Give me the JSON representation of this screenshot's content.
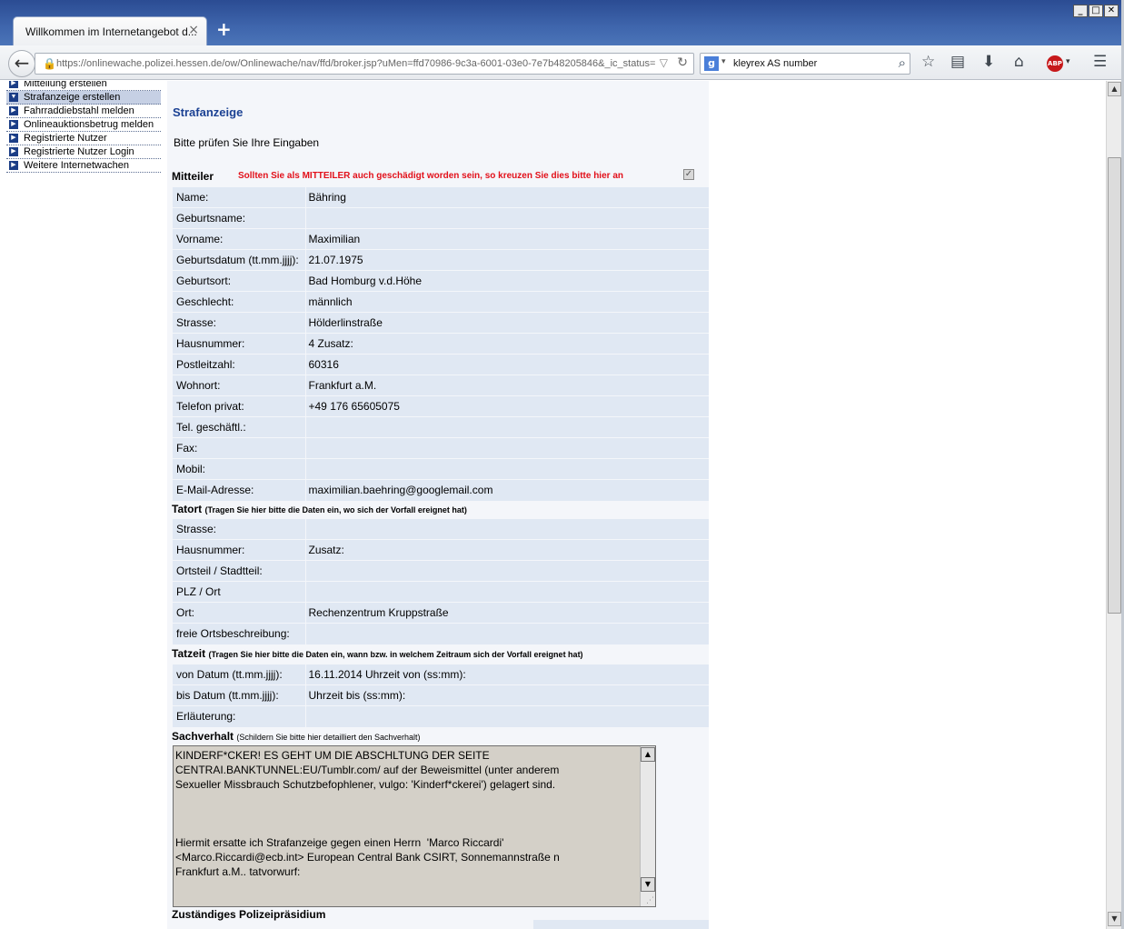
{
  "browser": {
    "tab_title": "Willkommen im Internetangebot d...",
    "tab_close": "×",
    "new_tab": "+",
    "url": "https://onlinewache.polizei.hessen.de/ow/Onlinewache/nav/ffd/broker.jsp?uMen=ffd70986-9c3a-6001-03e0-7e7b48205846&_ic_status=",
    "search_engine": "g",
    "search_text": "kleyrex AS number",
    "icons": [
      "back-icon",
      "lock-icon",
      "reload-icon",
      "search-icon",
      "bookmark-star-icon",
      "reading-list-icon",
      "download-icon",
      "home-icon",
      "adblock-icon",
      "menu-icon"
    ],
    "abp_label": "ABP"
  },
  "sidebar": {
    "items": [
      {
        "label": "Mitteilung erstellen"
      },
      {
        "label": "Strafanzeige erstellen",
        "active": true
      },
      {
        "label": "Fahrraddiebstahl melden"
      },
      {
        "label": "Onlineauktionsbetrug melden"
      },
      {
        "label": "Registrierte Nutzer"
      },
      {
        "label": "Registrierte Nutzer Login"
      },
      {
        "label": "Weitere Internetwachen"
      }
    ]
  },
  "main": {
    "title": "Strafanzeige",
    "subtitle": "Bitte prüfen Sie Ihre Eingaben",
    "mitteiler": {
      "heading": "Mitteiler",
      "hint": "Sollten Sie als MITTEILER auch geschädigt worden sein, so kreuzen Sie dies bitte hier an",
      "checked": true,
      "rows": [
        {
          "label": "Name:",
          "value": "Bähring"
        },
        {
          "label": "Geburtsname:",
          "value": ""
        },
        {
          "label": "Vorname:",
          "value": "Maximilian"
        },
        {
          "label": "Geburtsdatum (tt.mm.jjjj):",
          "value": "21.07.1975"
        },
        {
          "label": "Geburtsort:",
          "value": "Bad Homburg v.d.Höhe"
        },
        {
          "label": "Geschlecht:",
          "value": "männlich"
        },
        {
          "label": "Strasse:",
          "value": "Hölderlinstraße"
        },
        {
          "label": "Hausnummer:",
          "value": "4  Zusatz:"
        },
        {
          "label": "Postleitzahl:",
          "value": "60316"
        },
        {
          "label": "Wohnort:",
          "value": "Frankfurt a.M."
        },
        {
          "label": "Telefon privat:",
          "value": "+49 176 65605075"
        },
        {
          "label": "Tel. geschäftl.:",
          "value": ""
        },
        {
          "label": "Fax:",
          "value": ""
        },
        {
          "label": "Mobil:",
          "value": ""
        },
        {
          "label": "E-Mail-Adresse:",
          "value": "maximilian.baehring@googlemail.com"
        }
      ]
    },
    "tatort": {
      "heading": "Tatort",
      "note": "(Tragen Sie hier bitte die Daten ein, wo sich der Vorfall ereignet hat)",
      "rows": [
        {
          "label": "Strasse:",
          "value": ""
        },
        {
          "label": "Hausnummer:",
          "value": "  Zusatz:"
        },
        {
          "label": "Ortsteil / Stadtteil:",
          "value": ""
        },
        {
          "label": "PLZ / Ort",
          "value": ""
        },
        {
          "label": "Ort:",
          "value": "Rechenzentrum Kruppstraße"
        },
        {
          "label": "freie Ortsbeschreibung:",
          "value": ""
        }
      ]
    },
    "tatzeit": {
      "heading": "Tatzeit",
      "note": "(Tragen Sie hier bitte die Daten ein, wann bzw. in welchem Zeitraum sich der Vorfall ereignet hat)",
      "rows": [
        {
          "label": "von Datum (tt.mm.jjjj):",
          "value": "16.11.2014  Uhrzeit von (ss:mm):"
        },
        {
          "label": "bis Datum (tt.mm.jjjj):",
          "value": "Uhrzeit bis (ss:mm):"
        },
        {
          "label": "Erläuterung:",
          "value": ""
        }
      ]
    },
    "sachverhalt": {
      "heading": "Sachverhalt",
      "note": "(Schildern Sie bitte hier detailliert den Sachverhalt)",
      "text": "KINDERF*CKER! ES GEHT UM DIE ABSCHLTUNG DER SEITE\nCENTRAI.BANKTUNNEL:EU/Tumblr.com/ auf der Beweismittel (unter anderem\nSexueller Missbrauch Schutzbefophlener, vulgo: 'Kinderf*ckerei') gelagert sind.\n\n\n\nHiermit ersatte ich Strafanzeige gegen einen Herrn  'Marco Riccardi'\n<Marco.Riccardi@ecb.int> European Central Bank CSIRT, Sonnemannstraße n\nFrankfurt a.M.. tatvorwurf:"
    },
    "polizeipraesidium": {
      "heading": "Zuständiges Polizeipräsidium"
    }
  }
}
